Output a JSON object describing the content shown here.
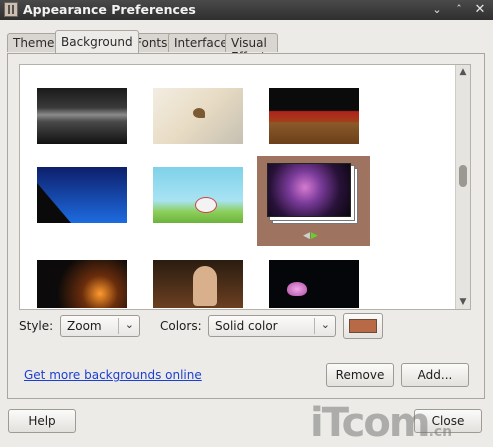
{
  "window": {
    "title": "Appearance Preferences"
  },
  "tabs": [
    "Theme",
    "Background",
    "Fonts",
    "Interface",
    "Visual Effects"
  ],
  "active_tab": "Background",
  "style": {
    "label": "Style:",
    "value": "Zoom"
  },
  "colors": {
    "label": "Colors:",
    "value": "Solid color",
    "swatch": "#b76a45"
  },
  "link": "Get more backgrounds online",
  "buttons": {
    "remove": "Remove",
    "add": "Add...",
    "help": "Help",
    "close": "Close"
  },
  "watermark": {
    "main": "iTcom",
    "suffix": ".cn"
  },
  "icons": [
    "app-icon",
    "chevron-down-icon",
    "maximize-icon",
    "close-icon",
    "cursor-icon",
    "scroll-up-icon",
    "scroll-down-icon"
  ]
}
